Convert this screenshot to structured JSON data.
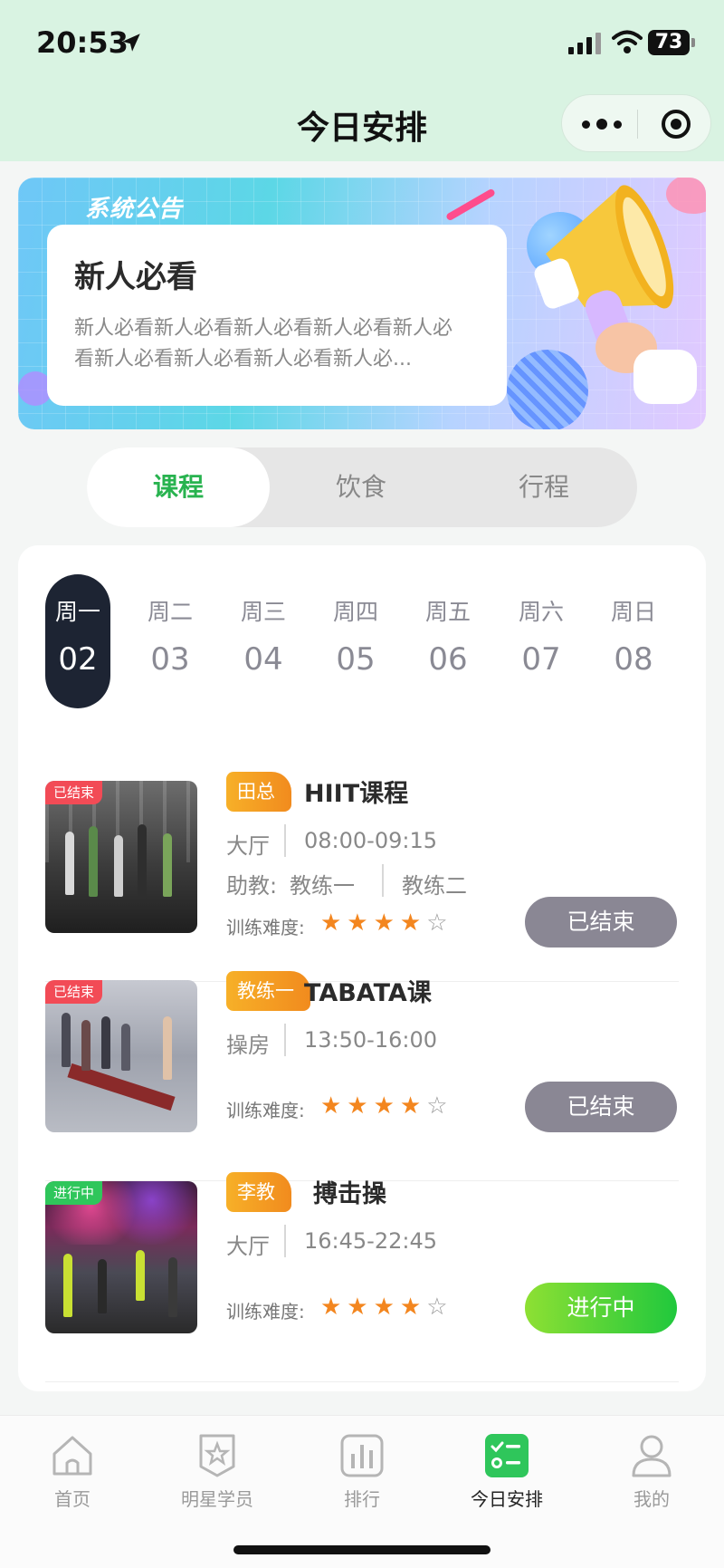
{
  "status_bar": {
    "time": "20:53",
    "battery": "73"
  },
  "nav": {
    "title": "今日安排"
  },
  "banner": {
    "tag": "系统公告",
    "title": "新人必看",
    "desc": "新人必看新人必看新人必看新人必看新人必看新人必看新人必看新人必看新人必..."
  },
  "tabs": [
    "课程",
    "饮食",
    "行程"
  ],
  "week": [
    {
      "wk": "周一",
      "date": "02"
    },
    {
      "wk": "周二",
      "date": "03"
    },
    {
      "wk": "周三",
      "date": "04"
    },
    {
      "wk": "周四",
      "date": "05"
    },
    {
      "wk": "周五",
      "date": "06"
    },
    {
      "wk": "周六",
      "date": "07"
    },
    {
      "wk": "周日",
      "date": "08"
    }
  ],
  "courses": [
    {
      "badge": "已结束",
      "coach": "田总",
      "name": "HIIT课程",
      "place": "大厅",
      "time": "08:00-09:15",
      "assist_label": "助教:",
      "assist1": "教练一",
      "assist2": "教练二",
      "difficulty_label": "训练难度:",
      "rating": 4,
      "button": "已结束"
    },
    {
      "badge": "已结束",
      "coach": "教练一",
      "name": "TABATA课",
      "place": "操房",
      "time": "13:50-16:00",
      "difficulty_label": "训练难度:",
      "rating": 4,
      "button": "已结束"
    },
    {
      "badge": "进行中",
      "coach": "李教",
      "name": "搏击操",
      "place": "大厅",
      "time": "16:45-22:45",
      "difficulty_label": "训练难度:",
      "rating": 4,
      "button": "进行中"
    }
  ],
  "tabbar": [
    {
      "label": "首页",
      "icon": "home-icon"
    },
    {
      "label": "明星学员",
      "icon": "star-badge-icon"
    },
    {
      "label": "排行",
      "icon": "bar-chart-icon"
    },
    {
      "label": "今日安排",
      "icon": "checklist-icon"
    },
    {
      "label": "我的",
      "icon": "user-icon"
    }
  ],
  "colors": {
    "accent": "#28b34f",
    "header_bg": "#d9f3e2",
    "tag_orange": "#f18b1e",
    "done_button": "#8a8794"
  }
}
